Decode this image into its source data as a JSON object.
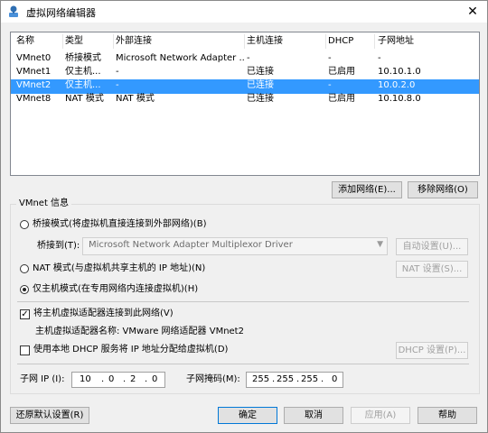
{
  "window": {
    "title": "虚拟网络编辑器"
  },
  "table": {
    "headers": [
      "名称",
      "类型",
      "外部连接",
      "主机连接",
      "DHCP",
      "子网地址"
    ],
    "rows": [
      [
        "VMnet0",
        "桥接模式",
        "Microsoft Network Adapter ...",
        "-",
        "-",
        "-"
      ],
      [
        "VMnet1",
        "仅主机...",
        "-",
        "已连接",
        "已启用",
        "10.10.1.0"
      ],
      [
        "VMnet2",
        "仅主机...",
        "-",
        "已连接",
        "-",
        "10.0.2.0"
      ],
      [
        "VMnet8",
        "NAT 模式",
        "NAT 模式",
        "已连接",
        "已启用",
        "10.10.8.0"
      ]
    ],
    "selected_row": 2
  },
  "list_buttons": {
    "add": "添加网络(E)...",
    "remove": "移除网络(O)"
  },
  "vmnet_info": {
    "title": "VMnet 信息",
    "bridge_radio": "桥接模式(将虚拟机直接连接到外部网络)(B)",
    "bridge_to_label": "桥接到(T):",
    "bridge_to_value": "Microsoft Network Adapter Multiplexor Driver",
    "auto_settings": "自动设置(U)...",
    "nat_radio": "NAT 模式(与虚拟机共享主机的 IP 地址)(N)",
    "nat_settings": "NAT 设置(S)...",
    "hostonly_radio": "仅主机模式(在专用网络内连接虚拟机)(H)",
    "connect_adapter_check": "将主机虚拟适配器连接到此网络(V)",
    "adapter_name_text": "主机虚拟适配器名称: VMware 网络适配器 VMnet2",
    "dhcp_check": "使用本地 DHCP 服务将 IP 地址分配给虚拟机(D)",
    "dhcp_settings": "DHCP 设置(P)...",
    "subnet_ip_label": "子网 IP (I):",
    "subnet_ip": [
      "10",
      "0",
      "2",
      "0"
    ],
    "subnet_mask_label": "子网掩码(M):",
    "subnet_mask": [
      "255",
      "255",
      "255",
      "0"
    ]
  },
  "bottom_buttons": {
    "restore": "还原默认设置(R)",
    "ok": "确定",
    "cancel": "取消",
    "apply": "应用(A)",
    "help": "帮助"
  },
  "colors": {
    "selection": "#3399ff"
  }
}
